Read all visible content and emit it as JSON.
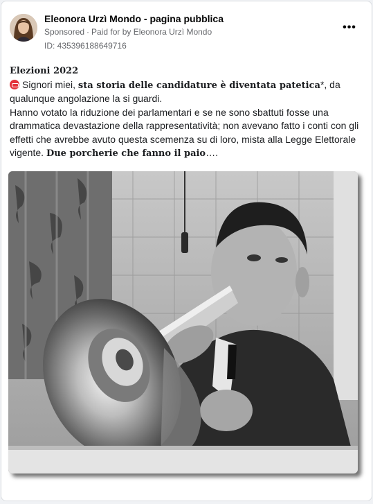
{
  "post": {
    "page_name": "Eleonora Urzì Mondo - pagina pubblica",
    "sponsored": "Sponsored",
    "dot": "·",
    "paid_for": "Paid for by Eleonora Urzì Mondo",
    "ad_id": "ID: 435396188649716",
    "more_icon": "more-horizontal-icon",
    "title": "Elezioni 2022",
    "p1_a": "Signori miei, ",
    "p1_bold": "sta storia delle candidature è diventata patetica",
    "p1_b": "*, da qualunque angolazione la si guardi.",
    "p2_a": "Hanno votato la riduzione dei parlamentari e se ne sono sbattuti fosse una drammatica devastazione della rappresentatività; non avevano fatto i conti con gli effetti che avrebbe avuto questa scemenza su di loro, mista alla Legge Elettorale vigente. ",
    "p2_bold": "Due porcherie che fanno il paio",
    "p2_end": "…."
  },
  "colors": {
    "emoji_red": "#e4323a",
    "muted": "#65676b"
  }
}
